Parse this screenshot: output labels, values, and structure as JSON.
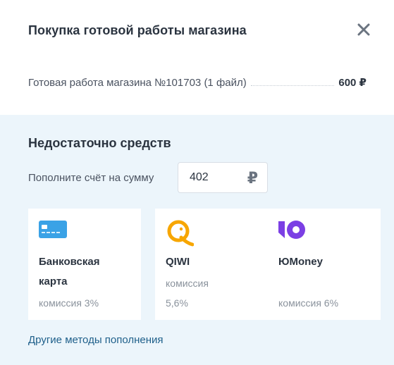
{
  "modal": {
    "title": "Покупка готовой работы магазина",
    "order": {
      "label": "Готовая работа магазина №101703 (1 файл)",
      "price": "600 ₽"
    }
  },
  "topup": {
    "heading": "Недостаточно средств",
    "label": "Пополните счёт на сумму",
    "amount": "402",
    "currency_symbol": "₽"
  },
  "methods": [
    {
      "name_line1": "Банковская",
      "name_line2": "карта",
      "fee": "комиссия 3%",
      "icon": "bank-card-icon"
    },
    {
      "name_line1": "QIWI",
      "fee_line1": "комиссия",
      "fee_line2": "5,6%",
      "icon": "qiwi-icon"
    },
    {
      "name_line1": "ЮMoney",
      "fee": "комиссия 6%",
      "icon": "yumoney-icon"
    }
  ],
  "other_methods_link": "Другие методы пополнения",
  "colors": {
    "accent_link": "#1e5f8a",
    "panel_bg": "#ecf5fb",
    "card_icon": "#3aa2e6",
    "qiwi": "#f7a600",
    "yumoney": "#7b3fe4"
  }
}
